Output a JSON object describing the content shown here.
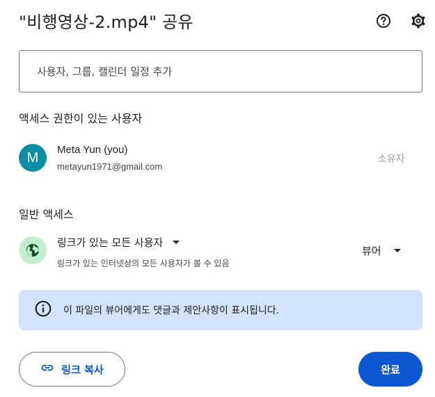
{
  "dialog": {
    "title": "\"비행영상-2.mp4\" 공유",
    "help_icon": "help-circle-icon",
    "settings_icon": "gear-icon"
  },
  "add_people": {
    "placeholder": "사용자, 그룹, 캘린더 일정 추가"
  },
  "people_with_access": {
    "heading": "액세스 권한이 있는 사용자",
    "users": [
      {
        "avatar_letter": "M",
        "avatar_color": "#0b8ea0",
        "name": "Meta Yun (you)",
        "email": "metayun1971@gmail.com",
        "role": "소유자"
      }
    ]
  },
  "general_access": {
    "heading": "일반 액세스",
    "icon": "globe-icon",
    "scope_label": "링크가 있는 모든 사용자",
    "scope_description": "링크가 있는 인터넷상의 모든 사용자가 볼 수 있음",
    "role_label": "뷰어"
  },
  "info": {
    "icon": "info-icon",
    "text": "이 파일의 뷰어에게도 댓글과 제안사항이 표시됩니다."
  },
  "footer": {
    "copy_link_label": "링크 복사",
    "copy_link_icon": "link-icon",
    "done_label": "완료"
  },
  "colors": {
    "accent": "#0b57d0",
    "info_bg": "#d3e3fd",
    "globe_bg": "#c4eed0"
  }
}
